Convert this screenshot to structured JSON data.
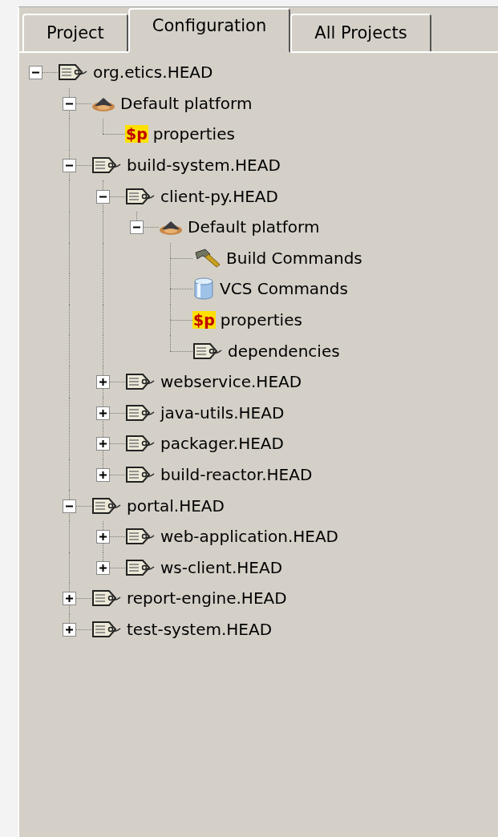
{
  "tabs": [
    {
      "label": "Project",
      "selected": false
    },
    {
      "label": "Configuration",
      "selected": true
    },
    {
      "label": "All Projects",
      "selected": false
    }
  ],
  "tree": [
    {
      "label": "org.etics.HEAD",
      "kind": "project",
      "expanded": true,
      "children": [
        {
          "label": "Default platform",
          "kind": "platform",
          "expanded": true,
          "children": [
            {
              "label": "properties",
              "kind": "properties",
              "symbol": "$p"
            }
          ]
        },
        {
          "label": "build-system.HEAD",
          "kind": "project",
          "expanded": true,
          "children": [
            {
              "label": "client-py.HEAD",
              "kind": "project",
              "expanded": true,
              "children": [
                {
                  "label": "Default platform",
                  "kind": "platform",
                  "expanded": true,
                  "children": [
                    {
                      "label": "Build Commands",
                      "kind": "build"
                    },
                    {
                      "label": "VCS Commands",
                      "kind": "vcs"
                    },
                    {
                      "label": "properties",
                      "kind": "properties",
                      "symbol": "$p"
                    },
                    {
                      "label": "dependencies",
                      "kind": "project"
                    }
                  ]
                }
              ]
            },
            {
              "label": "webservice.HEAD",
              "kind": "project",
              "expanded": false
            },
            {
              "label": "java-utils.HEAD",
              "kind": "project",
              "expanded": false
            },
            {
              "label": "packager.HEAD",
              "kind": "project",
              "expanded": false
            },
            {
              "label": "build-reactor.HEAD",
              "kind": "project",
              "expanded": false
            }
          ]
        },
        {
          "label": "portal.HEAD",
          "kind": "project",
          "expanded": true,
          "children": [
            {
              "label": "web-application.HEAD",
              "kind": "project",
              "expanded": false
            },
            {
              "label": "ws-client.HEAD",
              "kind": "project",
              "expanded": false
            }
          ]
        },
        {
          "label": "report-engine.HEAD",
          "kind": "project",
          "expanded": false
        },
        {
          "label": "test-system.HEAD",
          "kind": "project",
          "expanded": false
        }
      ]
    }
  ]
}
